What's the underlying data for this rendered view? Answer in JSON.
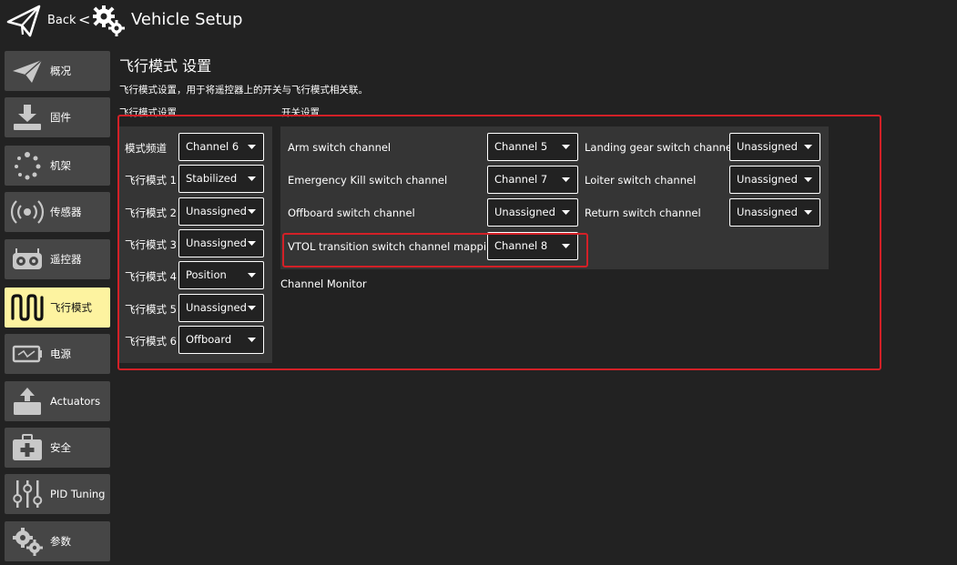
{
  "header": {
    "back_label": "Back",
    "chevron": "<",
    "title": "Vehicle Setup",
    "logo_icon": "paper-plane-icon",
    "title_icon": "gears-icon"
  },
  "sidebar": {
    "items": [
      {
        "label": "概况",
        "icon": "plane-icon"
      },
      {
        "label": "固件",
        "icon": "download-icon"
      },
      {
        "label": "机架",
        "icon": "frame-dots-icon"
      },
      {
        "label": "传感器",
        "icon": "radio-waves-icon"
      },
      {
        "label": "遥控器",
        "icon": "rc-transmitter-icon"
      },
      {
        "label": "飞行模式",
        "icon": "wave-icon",
        "active": true
      },
      {
        "label": "电源",
        "icon": "battery-icon"
      },
      {
        "label": "Actuators",
        "icon": "actuator-icon"
      },
      {
        "label": "安全",
        "icon": "first-aid-icon"
      },
      {
        "label": "PID Tuning",
        "icon": "sliders-icon"
      },
      {
        "label": "参数",
        "icon": "gears-icon"
      }
    ],
    "active_color": "#fdf3a0"
  },
  "main": {
    "title": "飞行模式 设置",
    "description": "飞行模式设置，用于将遥控器上的开关与飞行模式相关联。",
    "flight_modes": {
      "section_label": "飞行模式设置",
      "rows": [
        {
          "label": "模式频道",
          "value": "Channel 6"
        },
        {
          "label": "飞行模式 1",
          "value": "Stabilized"
        },
        {
          "label": "飞行模式 2",
          "value": "Unassigned"
        },
        {
          "label": "飞行模式 3",
          "value": "Unassigned"
        },
        {
          "label": "飞行模式 4",
          "value": "Position"
        },
        {
          "label": "飞行模式 5",
          "value": "Unassigned"
        },
        {
          "label": "飞行模式 6",
          "value": "Offboard"
        }
      ]
    },
    "switches": {
      "section_label": "开关设置",
      "left": [
        {
          "label": "Arm switch channel",
          "value": "Channel 5"
        },
        {
          "label": "Emergency Kill switch channel",
          "value": "Channel 7"
        },
        {
          "label": "Offboard switch channel",
          "value": "Unassigned"
        },
        {
          "label": "VTOL transition switch channel mapping",
          "value": "Channel 8"
        }
      ],
      "right": [
        {
          "label": "Landing gear switch channel",
          "value": "Unassigned"
        },
        {
          "label": "Loiter switch channel",
          "value": "Unassigned"
        },
        {
          "label": "Return switch channel",
          "value": "Unassigned"
        }
      ]
    },
    "channel_monitor_label": "Channel Monitor",
    "highlight_color": "#d32027"
  }
}
